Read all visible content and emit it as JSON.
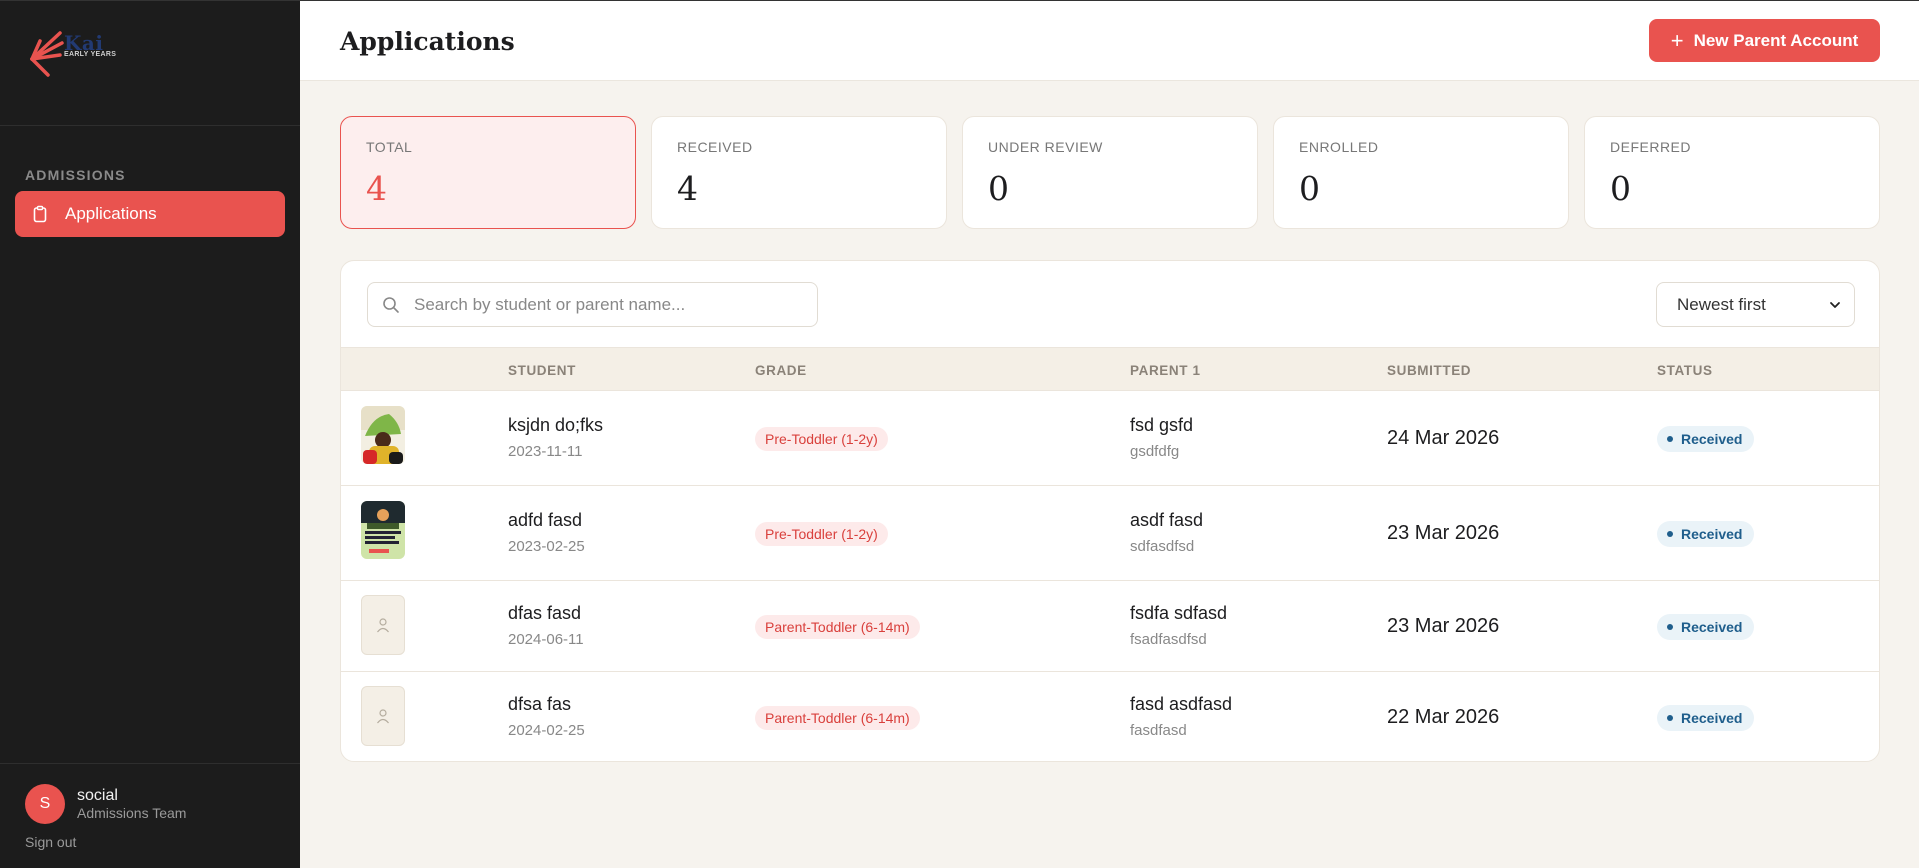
{
  "brand": {
    "name": "Kai",
    "tagline": "EARLY YEARS",
    "accent": "#e9534f"
  },
  "sidebar": {
    "section_label": "ADMISSIONS",
    "items": [
      {
        "label": "Applications",
        "icon": "clipboard-icon"
      }
    ],
    "user": {
      "initial": "S",
      "name": "social",
      "role": "Admissions Team"
    },
    "signout_label": "Sign out"
  },
  "header": {
    "title": "Applications",
    "new_button_label": "New Parent Account"
  },
  "stats": [
    {
      "label": "TOTAL",
      "value": "4"
    },
    {
      "label": "RECEIVED",
      "value": "4"
    },
    {
      "label": "UNDER REVIEW",
      "value": "0"
    },
    {
      "label": "ENROLLED",
      "value": "0"
    },
    {
      "label": "DEFERRED",
      "value": "0"
    }
  ],
  "search": {
    "placeholder": "Search by student or parent name..."
  },
  "sort": {
    "selected": "Newest first"
  },
  "table": {
    "columns": [
      "STUDENT",
      "GRADE",
      "PARENT 1",
      "SUBMITTED",
      "STATUS"
    ],
    "rows": [
      {
        "student": "ksjdn do;fks",
        "dob": "2023-11-11",
        "grade": "Pre-Toddler (1-2y)",
        "parent": "fsd gsfd",
        "parent_sub": "gsdfdfg",
        "submitted": "24 Mar 2026",
        "status": "Received",
        "photo": "photo"
      },
      {
        "student": "adfd fasd",
        "dob": "2023-02-25",
        "grade": "Pre-Toddler (1-2y)",
        "parent": "asdf fasd",
        "parent_sub": "sdfasdfsd",
        "submitted": "23 Mar 2026",
        "status": "Received",
        "photo": "photo"
      },
      {
        "student": "dfas fasd",
        "dob": "2024-06-11",
        "grade": "Parent-Toddler (6-14m)",
        "parent": "fsdfa sdfasd",
        "parent_sub": "fsadfasdfsd",
        "submitted": "23 Mar 2026",
        "status": "Received",
        "photo": "placeholder"
      },
      {
        "student": "dfsa fas",
        "dob": "2024-02-25",
        "grade": "Parent-Toddler (6-14m)",
        "parent": "fasd asdfasd",
        "parent_sub": "fasdfasd",
        "submitted": "22 Mar 2026",
        "status": "Received",
        "photo": "placeholder"
      }
    ]
  }
}
